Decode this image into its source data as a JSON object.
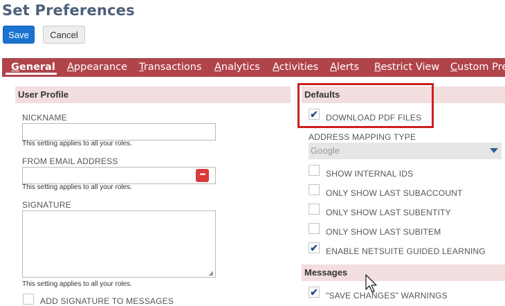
{
  "page": {
    "title": "Set Preferences"
  },
  "toolbar": {
    "save_label": "Save",
    "cancel_label": "Cancel"
  },
  "tabs": [
    {
      "label": "General",
      "active": true
    },
    {
      "label": "Appearance"
    },
    {
      "label": "Transactions"
    },
    {
      "label": "Analytics"
    },
    {
      "label": "Activities"
    },
    {
      "label": "Alerts"
    },
    {
      "label": "Restrict View"
    },
    {
      "label": "Custom Pref"
    }
  ],
  "user_profile": {
    "header": "User Profile",
    "nickname_label": "NICKNAME",
    "nickname_value": "",
    "nickname_hint": "This setting applies to all your roles.",
    "from_email_label": "FROM EMAIL ADDRESS",
    "from_email_value": "",
    "from_email_hint": "This setting applies to all your roles.",
    "more_icon": "•••",
    "signature_label": "SIGNATURE",
    "signature_value": "",
    "signature_hint": "This setting applies to all your roles.",
    "add_signature_label": "ADD SIGNATURE TO MESSAGES",
    "add_signature_checked": false
  },
  "defaults": {
    "header": "Defaults",
    "download_pdf_label": "DOWNLOAD PDF FILES",
    "download_pdf_checked": true,
    "address_mapping_label": "ADDRESS MAPPING TYPE",
    "address_mapping_value": "Google",
    "show_internal_ids_label": "SHOW INTERNAL IDS",
    "show_internal_ids_checked": false,
    "last_subaccount_label": "ONLY SHOW LAST SUBACCOUNT",
    "last_subaccount_checked": false,
    "last_subentity_label": "ONLY SHOW LAST SUBENTITY",
    "last_subentity_checked": false,
    "last_subitem_label": "ONLY SHOW LAST SUBITEM",
    "last_subitem_checked": false,
    "guided_learning_label": "ENABLE NETSUITE GUIDED LEARNING",
    "guided_learning_checked": true
  },
  "messages": {
    "header": "Messages",
    "save_changes_label": "\"SAVE CHANGES\" WARNINGS",
    "save_changes_checked": true
  },
  "colors": {
    "tab_bar": "#b0444a",
    "section_header": "#f2dede",
    "save_button": "#1a73d0",
    "highlight_box": "#cc1f1f",
    "checkmark": "#1e4d8c"
  },
  "icons": {
    "checkmark": "check-icon",
    "more": "more-dots-icon",
    "dropdown": "chevron-down-icon",
    "cursor": "mouse-pointer-icon"
  }
}
